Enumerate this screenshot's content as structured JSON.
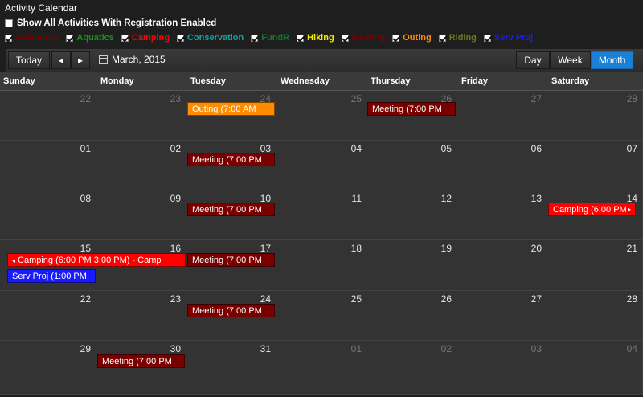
{
  "page": {
    "title": "Activity Calendar"
  },
  "options": {
    "show_all_label": "Show All Activities With Registration Enabled"
  },
  "filters": [
    {
      "label": "Adventure",
      "color": "#7a0000"
    },
    {
      "label": "Aquatics",
      "color": "#1a8f1a"
    },
    {
      "label": "Camping",
      "color": "#ff0000"
    },
    {
      "label": "Conservation",
      "color": "#1aa0a0"
    },
    {
      "label": "FundR",
      "color": "#0f7a2f"
    },
    {
      "label": "Hiking",
      "color": "#f0f000"
    },
    {
      "label": "Meeting",
      "color": "#7a0000"
    },
    {
      "label": "Outing",
      "color": "#ff8c00"
    },
    {
      "label": "Riding",
      "color": "#6b7a1a"
    },
    {
      "label": "Serv Proj",
      "color": "#1a1aff"
    }
  ],
  "toolbar": {
    "today": "Today",
    "prev_icon": "◂",
    "next_icon": "▸",
    "current_label": "March, 2015",
    "views": [
      "Day",
      "Week",
      "Month"
    ],
    "active_view": "Month"
  },
  "weekdays": [
    "Sunday",
    "Monday",
    "Tuesday",
    "Wednesday",
    "Thursday",
    "Friday",
    "Saturday"
  ],
  "weeks": [
    [
      "22",
      "23",
      "24",
      "25",
      "26",
      "27",
      "28"
    ],
    [
      "01",
      "02",
      "03",
      "04",
      "05",
      "06",
      "07"
    ],
    [
      "08",
      "09",
      "10",
      "11",
      "12",
      "13",
      "14"
    ],
    [
      "15",
      "16",
      "17",
      "18",
      "19",
      "20",
      "21"
    ],
    [
      "22",
      "23",
      "24",
      "25",
      "26",
      "27",
      "28"
    ],
    [
      "29",
      "30",
      "31",
      "01",
      "02",
      "03",
      "04"
    ]
  ],
  "events": [
    {
      "label": "Outing (7:00 AM",
      "color": "#ff8c00"
    },
    {
      "label": "Meeting (7:00 PM",
      "color": "#7a0000"
    },
    {
      "label": "Meeting (7:00 PM",
      "color": "#7a0000"
    },
    {
      "label": "Meeting (7:00 PM",
      "color": "#7a0000"
    },
    {
      "label": "Camping (6:00 PM",
      "color": "#ff0000"
    },
    {
      "label": "Camping (6:00 PM 3:00 PM) - Camp",
      "color": "#ff0000"
    },
    {
      "label": "Meeting (7:00 PM",
      "color": "#7a0000"
    },
    {
      "label": "Serv Proj (1:00 PM",
      "color": "#1a1aff"
    },
    {
      "label": "Meeting (7:00 PM",
      "color": "#7a0000"
    },
    {
      "label": "Meeting (7:00 PM",
      "color": "#7a0000"
    }
  ]
}
